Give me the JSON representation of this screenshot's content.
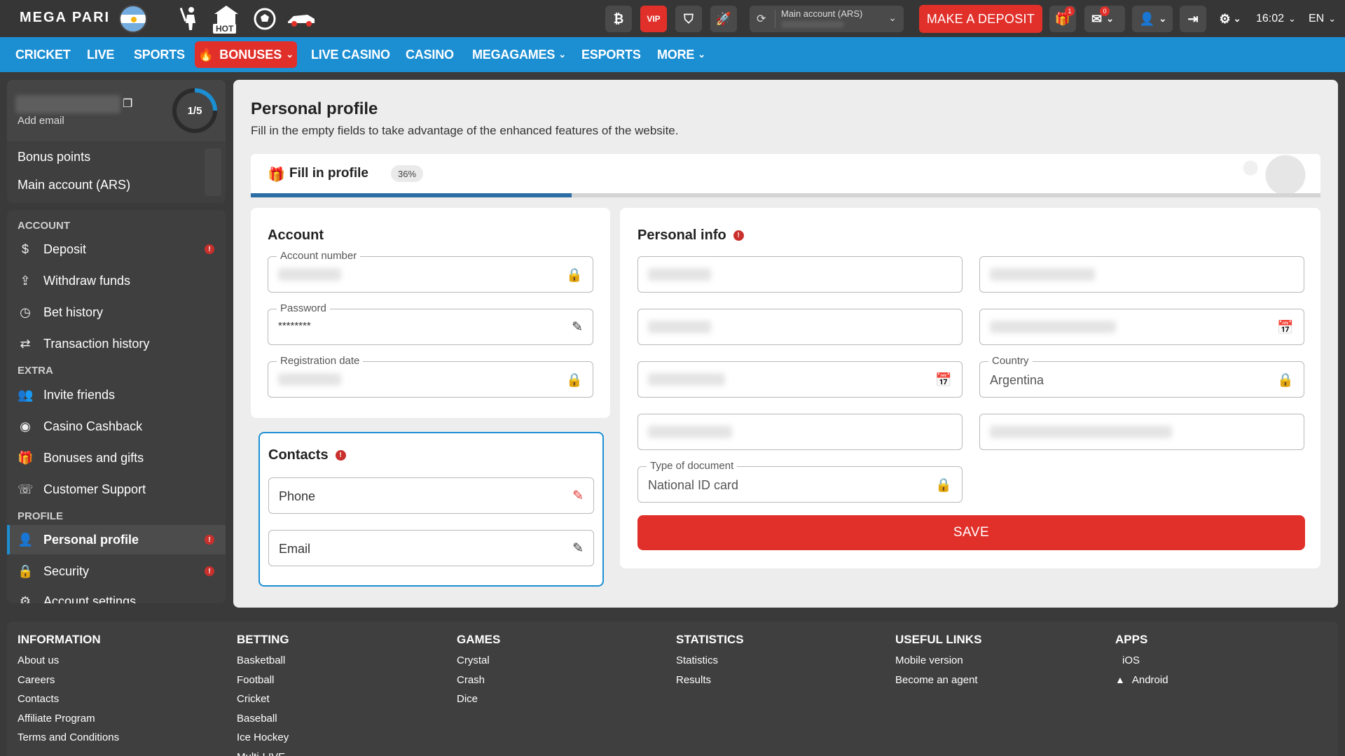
{
  "topbar": {
    "logo": "MEGA PARI",
    "hot_label": "HOT",
    "vip_label": "VIP",
    "account_select_label": "Main account (ARS)",
    "deposit_label": "MAKE A DEPOSIT",
    "gift_count": "1",
    "mail_count": "0",
    "time": "16:02",
    "language": "EN"
  },
  "nav": {
    "items": [
      "CRICKET",
      "LIVE",
      "SPORTS",
      "BONUSES",
      "LIVE CASINO",
      "CASINO",
      "MEGAGAMES",
      "ESPORTS",
      "MORE"
    ]
  },
  "sidebar": {
    "add_email": "Add email",
    "progress_ring": "1/5",
    "balances": [
      "Bonus points",
      "Main account (ARS)"
    ],
    "section_account": "ACCOUNT",
    "section_extra": "EXTRA",
    "section_profile": "PROFILE",
    "account_items": [
      "Deposit",
      "Withdraw funds",
      "Bet history",
      "Transaction history"
    ],
    "extra_items": [
      "Invite friends",
      "Casino Cashback",
      "Bonuses and gifts",
      "Customer Support"
    ],
    "profile_items": [
      "Personal profile",
      "Security",
      "Account settings"
    ]
  },
  "main": {
    "title": "Personal profile",
    "subtitle": "Fill in the empty fields to take advantage of the enhanced features of the website.",
    "fill_label": "Fill in profile",
    "fill_percent": "36%",
    "fill_progress": 0.3,
    "account": {
      "title": "Account",
      "account_number_label": "Account number",
      "password_label": "Password",
      "password_value": "********",
      "registration_label": "Registration date"
    },
    "contacts": {
      "title": "Contacts",
      "phone_placeholder": "Phone",
      "email_placeholder": "Email"
    },
    "personal": {
      "title": "Personal info",
      "country_label": "Country",
      "country_value": "Argentina",
      "doc_type_label": "Type of document",
      "doc_type_value": "National ID card",
      "save_label": "SAVE"
    }
  },
  "footer": {
    "information": {
      "title": "INFORMATION",
      "links": [
        "About us",
        "Careers",
        "Contacts",
        "Affiliate Program",
        "Terms and Conditions"
      ]
    },
    "betting": {
      "title": "BETTING",
      "links": [
        "Basketball",
        "Football",
        "Cricket",
        "Baseball",
        "Ice Hockey",
        "Multi-LIVE"
      ]
    },
    "games": {
      "title": "GAMES",
      "links": [
        "Crystal",
        "Crash",
        "Dice"
      ]
    },
    "statistics": {
      "title": "STATISTICS",
      "links": [
        "Statistics",
        "Results"
      ]
    },
    "useful": {
      "title": "USEFUL LINKS",
      "links": [
        "Mobile version",
        "Become an agent"
      ]
    },
    "apps": {
      "title": "APPS",
      "links": [
        "iOS",
        "Android"
      ]
    }
  },
  "colors": {
    "brand_blue": "#1c8fd3",
    "accent_red": "#e1302a",
    "dark_bg": "#363636"
  }
}
